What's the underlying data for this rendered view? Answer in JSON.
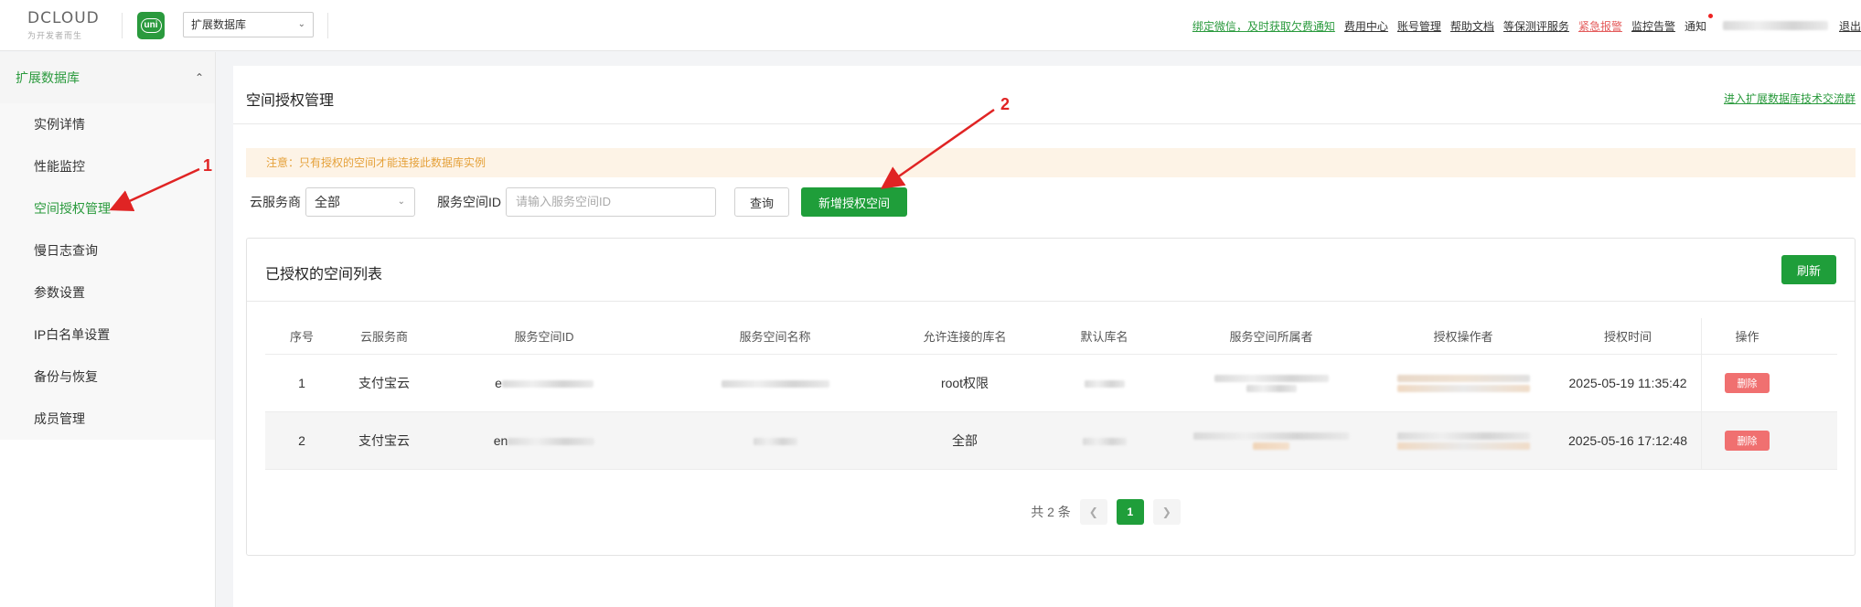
{
  "header": {
    "logo_text": "DCLOUD",
    "logo_subtitle": "为开发者而生",
    "uni_icon": "uni",
    "product_select": "扩展数据库",
    "nav": [
      {
        "label": "绑定微信，及时获取欠费通知",
        "color": "green"
      },
      {
        "label": "费用中心",
        "color": "default"
      },
      {
        "label": "账号管理",
        "color": "default"
      },
      {
        "label": "帮助文档",
        "color": "default"
      },
      {
        "label": "等保测评服务",
        "color": "default"
      },
      {
        "label": "紧急报警",
        "color": "red"
      },
      {
        "label": "监控告警",
        "color": "default"
      }
    ],
    "notice_label": "通知",
    "logout": "退出"
  },
  "sidebar": {
    "group_title": "扩展数据库",
    "items": [
      {
        "label": "实例详情"
      },
      {
        "label": "性能监控"
      },
      {
        "label": "空间授权管理",
        "active": true
      },
      {
        "label": "慢日志查询"
      },
      {
        "label": "参数设置"
      },
      {
        "label": "IP白名单设置"
      },
      {
        "label": "备份与恢复"
      },
      {
        "label": "成员管理"
      }
    ]
  },
  "main": {
    "title": "空间授权管理",
    "group_link": "进入扩展数据库技术交流群",
    "notice": "注意：只有授权的空间才能连接此数据库实例",
    "filter": {
      "provider_label": "云服务商",
      "provider_value": "全部",
      "space_id_label": "服务空间ID",
      "space_id_placeholder": "请输入服务空间ID",
      "query_button": "查询",
      "add_button": "新增授权空间"
    },
    "list": {
      "title": "已授权的空间列表",
      "refresh_button": "刷新",
      "columns": [
        "序号",
        "云服务商",
        "服务空间ID",
        "服务空间名称",
        "允许连接的库名",
        "默认库名",
        "服务空间所属者",
        "授权操作者",
        "授权时间",
        "操作"
      ],
      "rows": [
        {
          "index": "1",
          "provider": "支付宝云",
          "space_id_prefix": "e",
          "db_names": "root权限",
          "time": "2025-05-19 11:35:42",
          "action": "删除"
        },
        {
          "index": "2",
          "provider": "支付宝云",
          "space_id_prefix": "en",
          "db_names": "全部",
          "time": "2025-05-16 17:12:48",
          "action": "删除"
        }
      ]
    },
    "pagination": {
      "total": "共 2 条",
      "current": "1",
      "prev_icon": "chevron-left-icon",
      "next_icon": "chevron-right-icon"
    }
  },
  "annotations": {
    "arrow1_number": "1",
    "arrow2_number": "2",
    "color": "#e02424"
  },
  "colors": {
    "accent": "#1f9e3a",
    "danger": "#f07070",
    "notice_bg": "#fdf3e6",
    "notice_text": "#e5a13a"
  }
}
